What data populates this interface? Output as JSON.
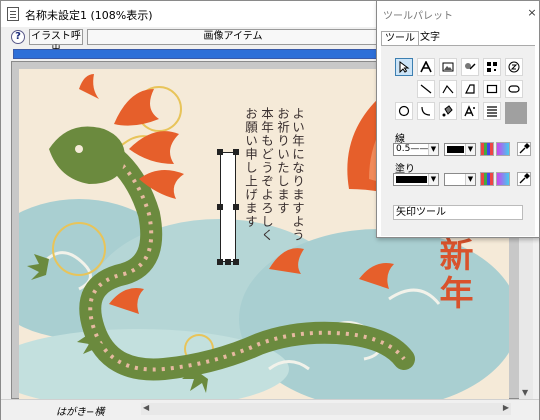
{
  "window": {
    "title": "名称未設定1 (108%表示)",
    "toolbar": {
      "help_label": "?",
      "illust_button": "イラスト呼出",
      "category_field": "画像アイテム"
    },
    "status": "はがき−横"
  },
  "card": {
    "greeting_columns": [
      "よい年になりますよう",
      "お祈りいたします",
      "本年もどうぞよろしく",
      "お願い申し上げます"
    ],
    "new_year_text": "新年"
  },
  "palette": {
    "title": "ツールパレット",
    "close_label": "×",
    "tabs": [
      "ツール",
      "文字"
    ],
    "line_label": "線",
    "line_width_value": "0.5——",
    "fill_label": "塗り",
    "tool_name_value": "矢印ツール"
  },
  "colors": {
    "accent": "#2d6fd8",
    "card_background": "#f5ead8",
    "dragon_green": "#6b8a3e",
    "dragon_orange": "#e65f2b",
    "cloud_blue": "#a9cfd1",
    "new_year_red": "#d9522c"
  },
  "icons": {
    "arrow_tool": "cursor-arrow",
    "text_tool": "letter-A",
    "image_tool": "picture",
    "illust_tool": "clip-art",
    "barcode_tool": "qr-code",
    "stamp_tool": "stamp"
  }
}
